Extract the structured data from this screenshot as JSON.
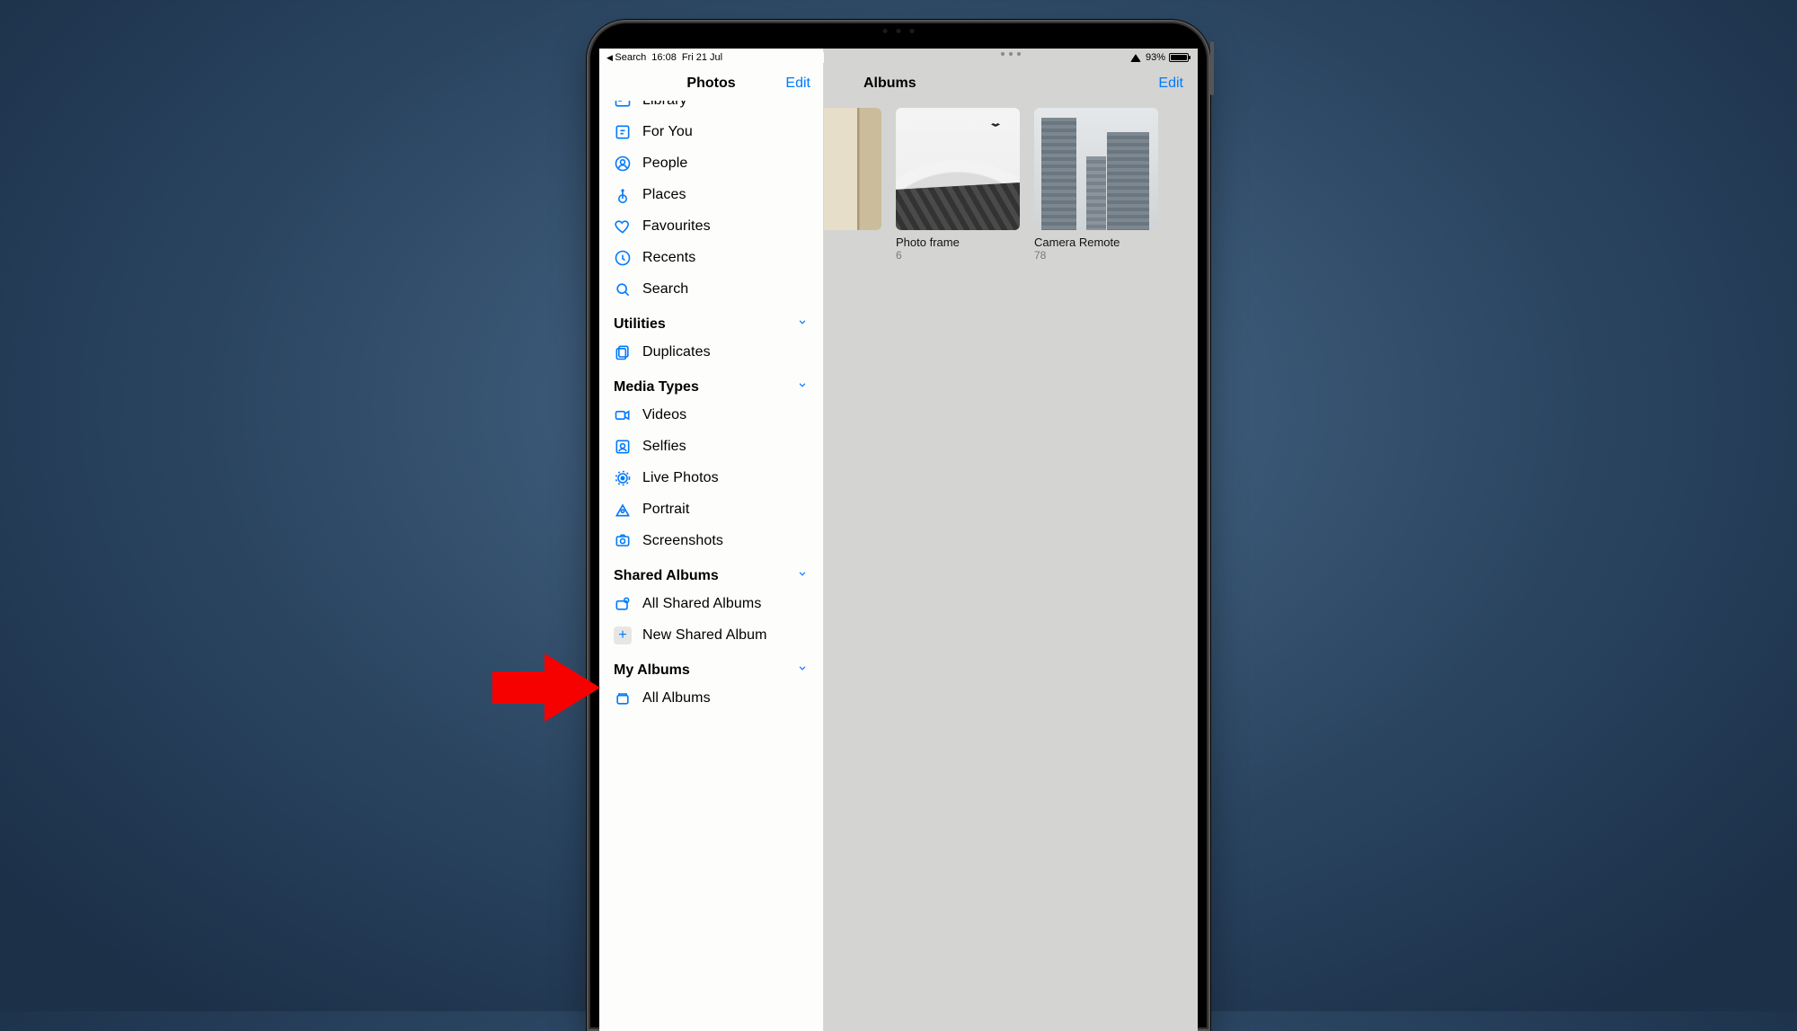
{
  "status": {
    "back_label": "Search",
    "time": "16:08",
    "date": "Fri 21 Jul",
    "battery_pct": "93%"
  },
  "sidebar": {
    "title": "Photos",
    "edit_label": "Edit",
    "top_items": [
      {
        "id": "library",
        "label": "Library"
      },
      {
        "id": "for-you",
        "label": "For You"
      },
      {
        "id": "people",
        "label": "People"
      },
      {
        "id": "places",
        "label": "Places"
      },
      {
        "id": "favourites",
        "label": "Favourites"
      },
      {
        "id": "recents",
        "label": "Recents"
      },
      {
        "id": "search",
        "label": "Search"
      }
    ],
    "sections": [
      {
        "id": "utilities",
        "title": "Utilities",
        "items": [
          {
            "id": "duplicates",
            "label": "Duplicates"
          }
        ]
      },
      {
        "id": "media-types",
        "title": "Media Types",
        "items": [
          {
            "id": "videos",
            "label": "Videos"
          },
          {
            "id": "selfies",
            "label": "Selfies"
          },
          {
            "id": "live-photos",
            "label": "Live Photos"
          },
          {
            "id": "portrait",
            "label": "Portrait"
          },
          {
            "id": "screenshots",
            "label": "Screenshots"
          }
        ]
      },
      {
        "id": "shared-albums",
        "title": "Shared Albums",
        "items": [
          {
            "id": "all-shared",
            "label": "All Shared Albums"
          },
          {
            "id": "new-shared",
            "label": "New Shared Album"
          }
        ]
      },
      {
        "id": "my-albums",
        "title": "My Albums",
        "items": [
          {
            "id": "all-albums",
            "label": "All Albums"
          }
        ]
      }
    ]
  },
  "content": {
    "title": "Albums",
    "edit_label": "Edit",
    "albums": [
      {
        "id": "cropped",
        "name": "",
        "count": ""
      },
      {
        "id": "photo-frame",
        "name": "Photo frame",
        "count": "6"
      },
      {
        "id": "camera-remote",
        "name": "Camera Remote",
        "count": "78"
      }
    ]
  },
  "annotation": {
    "arrow_target": "my-albums"
  },
  "colors": {
    "accent": "#007aff",
    "sidebar_bg": "#fdfdfb",
    "content_bg": "#d4d4d2",
    "arrow": "#f60000"
  }
}
